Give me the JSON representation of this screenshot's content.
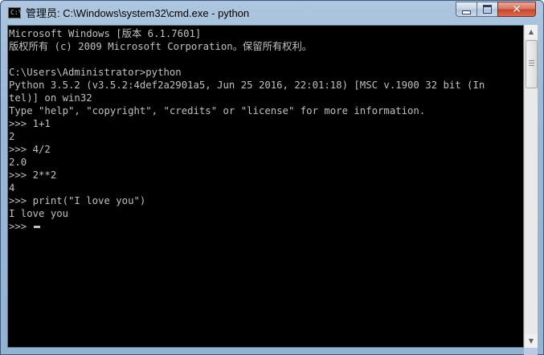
{
  "window": {
    "title": "管理员: C:\\Windows\\system32\\cmd.exe - python",
    "icon": "cmd-icon",
    "icon_text": "C:\\"
  },
  "controls": {
    "minimize_icon": "minimize-icon",
    "maximize_icon": "maximize-icon",
    "close_icon": "close-icon",
    "close_glyph": "✕"
  },
  "console": {
    "background": "#000000",
    "foreground": "#c0c0c0",
    "lines": [
      "Microsoft Windows [版本 6.1.7601]",
      "版权所有 (c) 2009 Microsoft Corporation。保留所有权利。",
      "",
      "C:\\Users\\Administrator>python",
      "Python 3.5.2 (v3.5.2:4def2a2901a5, Jun 25 2016, 22:01:18) [MSC v.1900 32 bit (In",
      "tel)] on win32",
      "Type \"help\", \"copyright\", \"credits\" or \"license\" for more information.",
      ">>> 1+1",
      "2",
      ">>> 4/2",
      "2.0",
      ">>> 2**2",
      "4",
      ">>> print(\"I love you\")",
      "I love you"
    ],
    "prompt": ">>> "
  },
  "scrollbar": {
    "up_glyph": "▲",
    "down_glyph": "▼"
  }
}
